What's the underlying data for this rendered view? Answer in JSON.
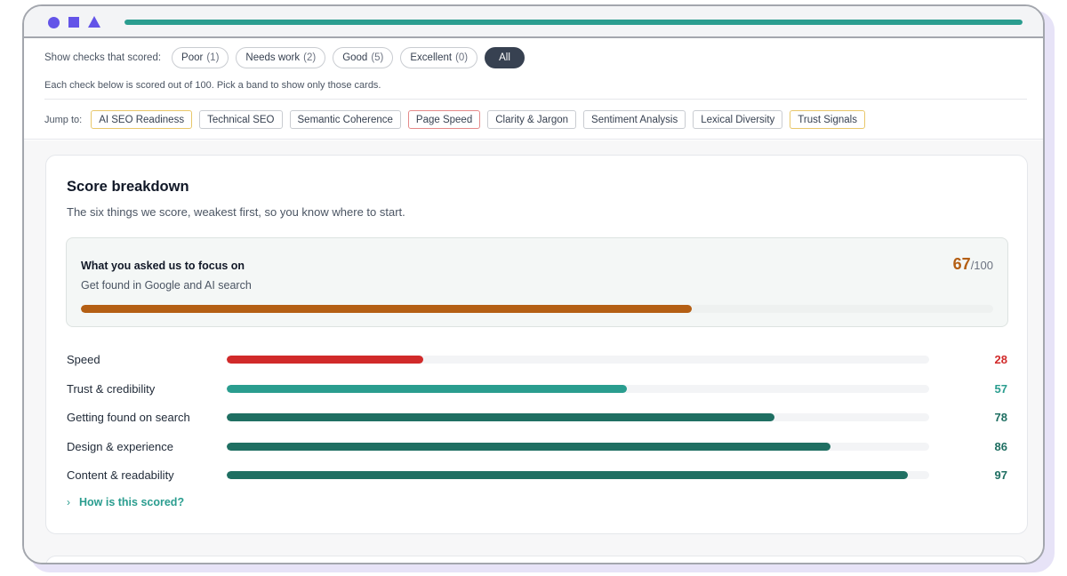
{
  "colors": {
    "accent": "#6354e8",
    "teal": "#2a9d8f",
    "dark_teal": "#1f6f62",
    "orange": "#b45f14",
    "red": "#d12a2a"
  },
  "toolbar": {
    "shape_icons": [
      "circle-icon",
      "square-icon",
      "triangle-icon"
    ],
    "url_progress": 1.0
  },
  "filters": {
    "label": "Show checks that scored:",
    "options": [
      {
        "label": "Poor",
        "count": "(1)"
      },
      {
        "label": "Needs work",
        "count": "(2)"
      },
      {
        "label": "Good",
        "count": "(5)"
      },
      {
        "label": "Excellent",
        "count": "(0)"
      }
    ],
    "all_label": "All",
    "helper": "Each check below is scored out of 100. Pick a band to show only those cards."
  },
  "jump": {
    "label": "Jump to:",
    "chips": [
      {
        "label": "AI SEO Readiness",
        "border": "#e8c76a"
      },
      {
        "label": "Technical SEO",
        "border": "#c9ccd1"
      },
      {
        "label": "Semantic Coherence",
        "border": "#c9ccd1"
      },
      {
        "label": "Page Speed",
        "border": "#e58a8a"
      },
      {
        "label": "Clarity & Jargon",
        "border": "#c9ccd1"
      },
      {
        "label": "Sentiment Analysis",
        "border": "#c9ccd1"
      },
      {
        "label": "Lexical Diversity",
        "border": "#c9ccd1"
      },
      {
        "label": "Trust Signals",
        "border": "#e8c76a"
      }
    ]
  },
  "breakdown": {
    "title": "Score breakdown",
    "subtitle": "The six things we score, weakest first, so you know where to start.",
    "focus": {
      "title": "What you asked us to focus on",
      "subtitle": "Get found in Google and AI search",
      "score": "67",
      "denominator": "/100",
      "value": 67
    },
    "metrics": [
      {
        "label": "Speed",
        "value": 28,
        "color": "#d12a2a"
      },
      {
        "label": "Trust & credibility",
        "value": 57,
        "color": "#2a9d8f"
      },
      {
        "label": "Getting found on search",
        "value": 78,
        "color": "#1f6f62"
      },
      {
        "label": "Design & experience",
        "value": 86,
        "color": "#1f6f62"
      },
      {
        "label": "Content & readability",
        "value": 97,
        "color": "#1f6f62"
      }
    ],
    "how_link": "How is this scored?"
  }
}
